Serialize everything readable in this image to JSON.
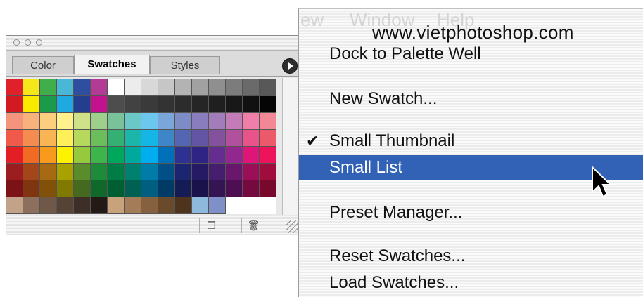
{
  "watermark": "www.vietphotoshop.com",
  "background_menu_text": [
    "ew",
    "Window",
    "Help"
  ],
  "palette": {
    "tabs": [
      {
        "label": "Color",
        "active": false
      },
      {
        "label": "Swatches",
        "active": true
      },
      {
        "label": "Styles",
        "active": false
      }
    ],
    "bottom_buttons": [
      {
        "icon": "new-swatch-icon",
        "glyph": "❐"
      },
      {
        "icon": "trash-icon",
        "glyph": "🗑"
      }
    ],
    "swatch_rows": [
      [
        "#e0202a",
        "#f5e81a",
        "#3fae4b",
        "#49b7d6",
        "#2e4fa0",
        "#b23c95",
        "#ffffff",
        "#ececec",
        "#d8d8d8",
        "#c6c6c6",
        "#b3b3b3",
        "#a1a1a1",
        "#8f8f8f",
        "#7c7c7c",
        "#6a6a6a",
        "#585858"
      ],
      [
        "#d11a22",
        "#f9ea00",
        "#1a9a4a",
        "#1eaae0",
        "#233d8f",
        "#c2128d",
        "#4d4d4d",
        "#424242",
        "#3a3a3a",
        "#333333",
        "#2c2c2c",
        "#252525",
        "#1f1f1f",
        "#181818",
        "#111111",
        "#050505"
      ],
      [
        "#f4947d",
        "#f7b27c",
        "#fbcf7e",
        "#fff28c",
        "#cfe28a",
        "#9ed08b",
        "#78c39a",
        "#6ac9c6",
        "#6cc7ee",
        "#7aa6d9",
        "#7d8bc7",
        "#8a7dbd",
        "#a27cbb",
        "#c37cb8",
        "#ef7ea8",
        "#f28896"
      ],
      [
        "#ef5a4a",
        "#f48c50",
        "#f9b553",
        "#fff05a",
        "#b6d85c",
        "#6cbd5c",
        "#35b073",
        "#1bb5aa",
        "#15b6e6",
        "#3f86c9",
        "#5466b1",
        "#6354a4",
        "#84519f",
        "#b1509d",
        "#e8548a",
        "#ec5a6a"
      ],
      [
        "#e31e25",
        "#f26b22",
        "#f89b1d",
        "#fff200",
        "#97c93c",
        "#3eb54a",
        "#00a75d",
        "#00a99d",
        "#00aeef",
        "#0070b9",
        "#2e3192",
        "#2f2384",
        "#662d91",
        "#92278f",
        "#e0157a",
        "#ed145b"
      ],
      [
        "#9c1d20",
        "#a3471a",
        "#a66a12",
        "#a8a200",
        "#5b8c2b",
        "#1d8b39",
        "#007d44",
        "#00806e",
        "#007ca8",
        "#004f87",
        "#1c2570",
        "#251a63",
        "#461e6e",
        "#68176d",
        "#9a0f57",
        "#9e0d3c"
      ],
      [
        "#7b1215",
        "#7e3510",
        "#815009",
        "#807a00",
        "#456a1f",
        "#10692a",
        "#005f32",
        "#006152",
        "#005f80",
        "#003b66",
        "#141b55",
        "#1a124b",
        "#341453",
        "#4e0f52",
        "#750a41",
        "#78092c"
      ],
      [
        "#c2a38a",
        "#8c6f5c",
        "#705848",
        "#574236",
        "#3d2e27",
        "#231a17",
        "#c7a27a",
        "#a47d58",
        "#86613f",
        "#6a4a2c",
        "#4e341c",
        "#8fb9dc",
        "#7f8fc7",
        "",
        "",
        ""
      ]
    ]
  },
  "menu": {
    "items": [
      {
        "label": "Dock to Palette Well",
        "checked": false,
        "selected": false
      },
      {
        "label": "New Swatch...",
        "checked": false,
        "selected": false
      },
      {
        "label": "Small Thumbnail",
        "checked": true,
        "selected": false
      },
      {
        "label": "Small List",
        "checked": false,
        "selected": true
      },
      {
        "label": "Preset Manager...",
        "checked": false,
        "selected": false
      },
      {
        "label": "Reset Swatches...",
        "checked": false,
        "selected": false
      },
      {
        "label": "Load Swatches...",
        "checked": false,
        "selected": false
      }
    ],
    "check_glyph": "✔"
  }
}
